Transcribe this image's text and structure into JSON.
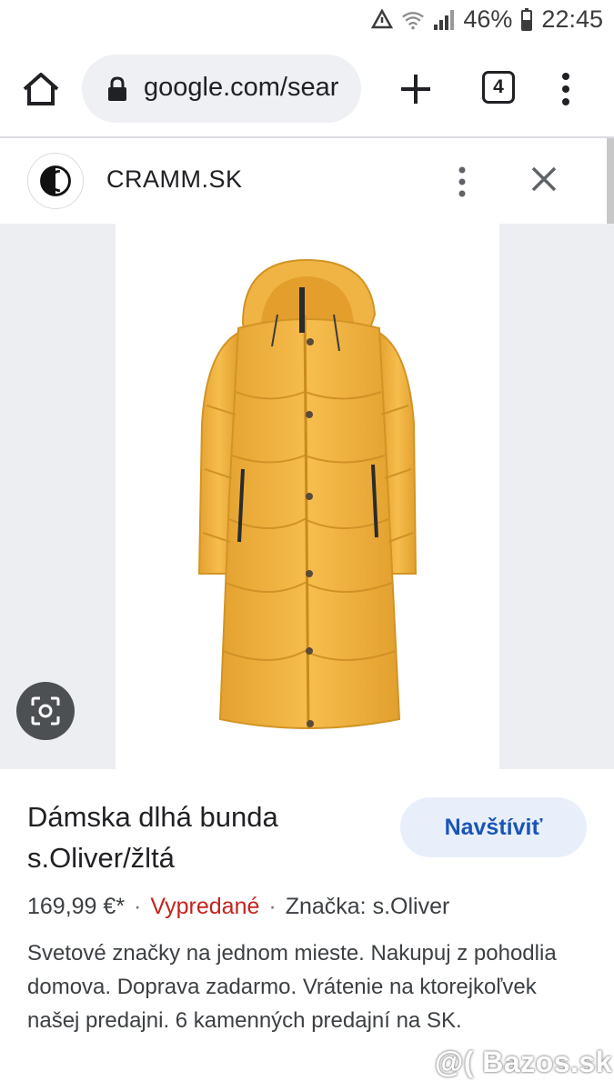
{
  "status_bar": {
    "battery": "46%",
    "time": "22:45"
  },
  "browser": {
    "url": "google.com/sear",
    "tab_count": "4"
  },
  "source": {
    "name": "CRAMM.SK"
  },
  "product": {
    "title_line1": "Dámska dlhá bunda",
    "title_line2": "s.Oliver/žltá",
    "visit_label": "Navštíviť",
    "price": "169,99 €*",
    "availability": "Vypredané",
    "separator": "·",
    "brand": "Značka: s.Oliver",
    "description": "Svetové značky na jednom mieste. Nakupuj z pohodlia domova. Doprava zadarmo. Vrátenie na ktorejkoľvek našej predajni. 6 kamenných predajní na SK.",
    "image_color": "#f2b33f"
  },
  "watermark": "@( Bazos.sk"
}
